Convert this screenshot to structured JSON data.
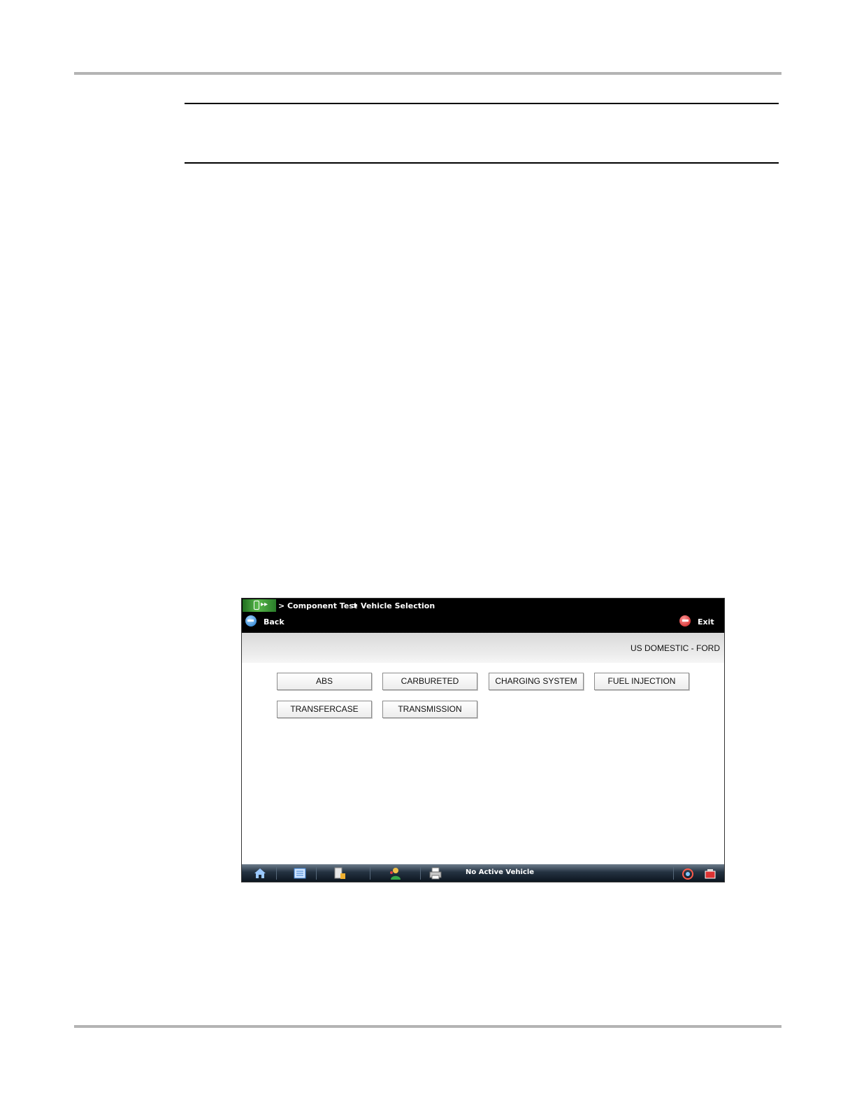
{
  "screen": {
    "breadcrumb": [
      "> Component Test",
      "> Vehicle Selection"
    ],
    "back_label": "Back",
    "exit_label": "Exit",
    "vehicle_label": "US DOMESTIC - FORD",
    "buttons": [
      "ABS",
      "CARBURETED",
      "CHARGING SYSTEM",
      "FUEL INJECTION",
      "TRANSFERCASE",
      "TRANSMISSION"
    ],
    "status_text": "No Active Vehicle"
  }
}
